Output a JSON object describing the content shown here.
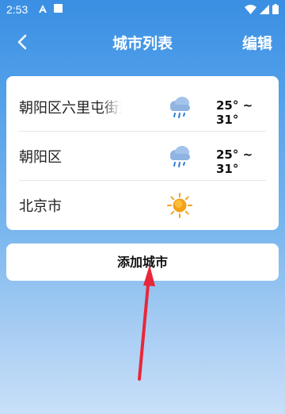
{
  "status_bar": {
    "time": "2:53",
    "icons": [
      "notification-a-icon",
      "notification-box-icon",
      "wifi-icon",
      "signal-icon",
      "battery-icon"
    ]
  },
  "header": {
    "title": "城市列表",
    "edit_label": "编辑",
    "back_icon": "back-arrow-icon"
  },
  "cities": [
    {
      "name": "朝阳区六里屯街道",
      "weather_icon": "rain-cloud-icon",
      "temp": "25° ~ 31°"
    },
    {
      "name": "朝阳区",
      "weather_icon": "rain-cloud-icon",
      "temp": "25° ~ 31°"
    },
    {
      "name": "北京市",
      "weather_icon": "sun-icon",
      "temp": ""
    }
  ],
  "add_button": {
    "label": "添加城市"
  },
  "colors": {
    "header_blue": "#3a8fe3",
    "card_bg": "#ffffff",
    "arrow_red": "#e8273a"
  }
}
